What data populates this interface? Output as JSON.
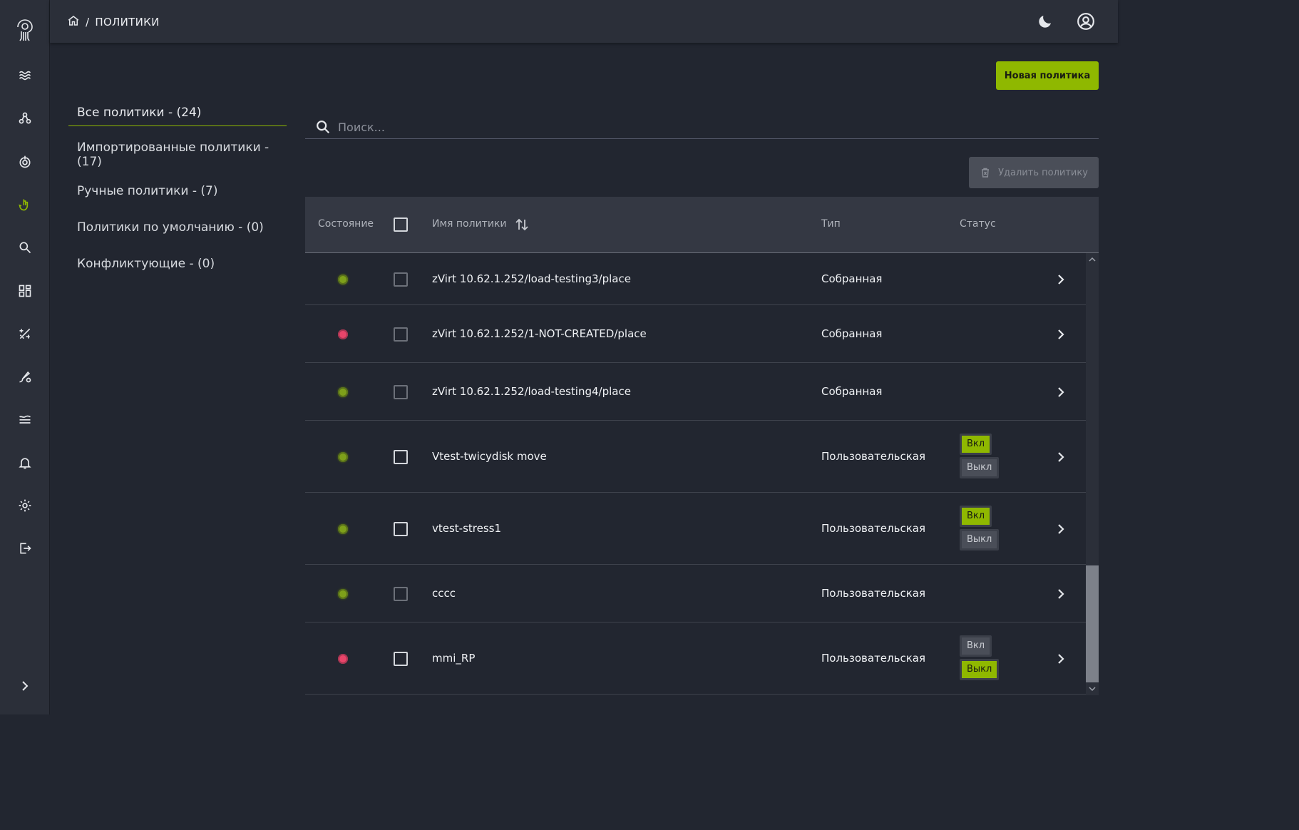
{
  "breadcrumb": {
    "separator": "/",
    "title": "ПОЛИТИКИ"
  },
  "header": {
    "theme_icon": "moon-icon",
    "account_icon": "user-circle-icon"
  },
  "sidebar": {
    "items": [
      {
        "icon": "waves-icon"
      },
      {
        "icon": "nodes-icon"
      },
      {
        "icon": "power-target-icon"
      },
      {
        "icon": "policy-hand-icon",
        "active": true
      },
      {
        "icon": "search-icon"
      },
      {
        "icon": "dashboard-icon"
      },
      {
        "icon": "tools-icon"
      },
      {
        "icon": "brush-gear-icon"
      },
      {
        "icon": "layers-icon"
      },
      {
        "icon": "bell-icon"
      },
      {
        "icon": "settings-icon"
      },
      {
        "icon": "logout-icon"
      }
    ]
  },
  "actions": {
    "new_policy": "Новая политика",
    "delete_policy": "Удалить политику"
  },
  "filters": [
    "Все политики - (24)",
    "Импортированные политики - (17)",
    "Ручные политики - (7)",
    "Политики по умолчанию - (0)",
    "Конфликтующие - (0)"
  ],
  "search": {
    "placeholder": "Поиск..."
  },
  "table": {
    "columns": {
      "state": "Состояние",
      "name": "Имя политики",
      "type": "Тип",
      "status": "Статус"
    },
    "rows": [
      {
        "state": "ok",
        "name": "zVirt 10.62.1.252/load-testing3/place",
        "type": "Собранная",
        "status": null
      },
      {
        "state": "error",
        "name": "zVirt 10.62.1.252/1-NOT-CREATED/place",
        "type": "Собранная",
        "status": null
      },
      {
        "state": "ok",
        "name": "zVirt 10.62.1.252/load-testing4/place",
        "type": "Собранная",
        "status": null
      },
      {
        "state": "ok",
        "name": "Vtest-twicydisk move",
        "type": "Пользовательская",
        "status": "on"
      },
      {
        "state": "ok",
        "name": "vtest-stress1",
        "type": "Пользовательская",
        "status": "on"
      },
      {
        "state": "ok",
        "name": "cccc",
        "type": "Пользовательская",
        "status": null
      },
      {
        "state": "error",
        "name": "mmi_RP",
        "type": "Пользовательская",
        "status": "off"
      }
    ],
    "status_labels": {
      "on": "Вкл",
      "off": "Выкл"
    }
  },
  "colors": {
    "accent": "#8fb800",
    "state_ok": "#7ea01a",
    "state_error": "#e8456a"
  }
}
